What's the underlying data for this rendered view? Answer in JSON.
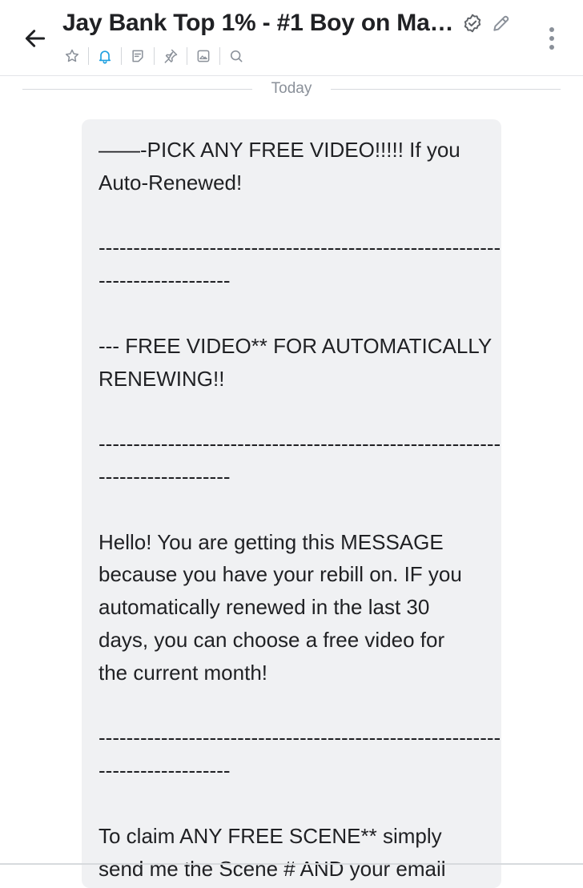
{
  "header": {
    "title": "Jay Bank Top 1% - #1 Boy on Ma…",
    "toolbar_icons": [
      "star-icon",
      "bell-icon",
      "notes-icon",
      "pin-icon",
      "media-icon",
      "search-icon"
    ]
  },
  "divider": {
    "label": "Today"
  },
  "message": {
    "lines": [
      "——-PICK ANY FREE VIDEO!!!!! If you",
      "Auto-Renewed!",
      "",
      "--------------------------------------------------------------",
      "-------------------",
      "",
      "--- FREE VIDEO** FOR AUTOMATICALLY",
      "RENEWING!!",
      "",
      "--------------------------------------------------------------",
      "-------------------",
      "",
      "Hello! You are getting this MESSAGE",
      "because you have your rebill on. IF you",
      "automatically renewed in the last 30",
      "days, you can choose a free video for",
      "the current month!",
      "",
      "--------------------------------------------------------------",
      "-------------------",
      "",
      "To claim ANY FREE SCENE** simply",
      "send me the Scene # AND your email"
    ]
  },
  "colors": {
    "bubble_bg": "#f0f1f3",
    "accent": "#1fa0e0",
    "icon_gray": "#8a9099"
  }
}
